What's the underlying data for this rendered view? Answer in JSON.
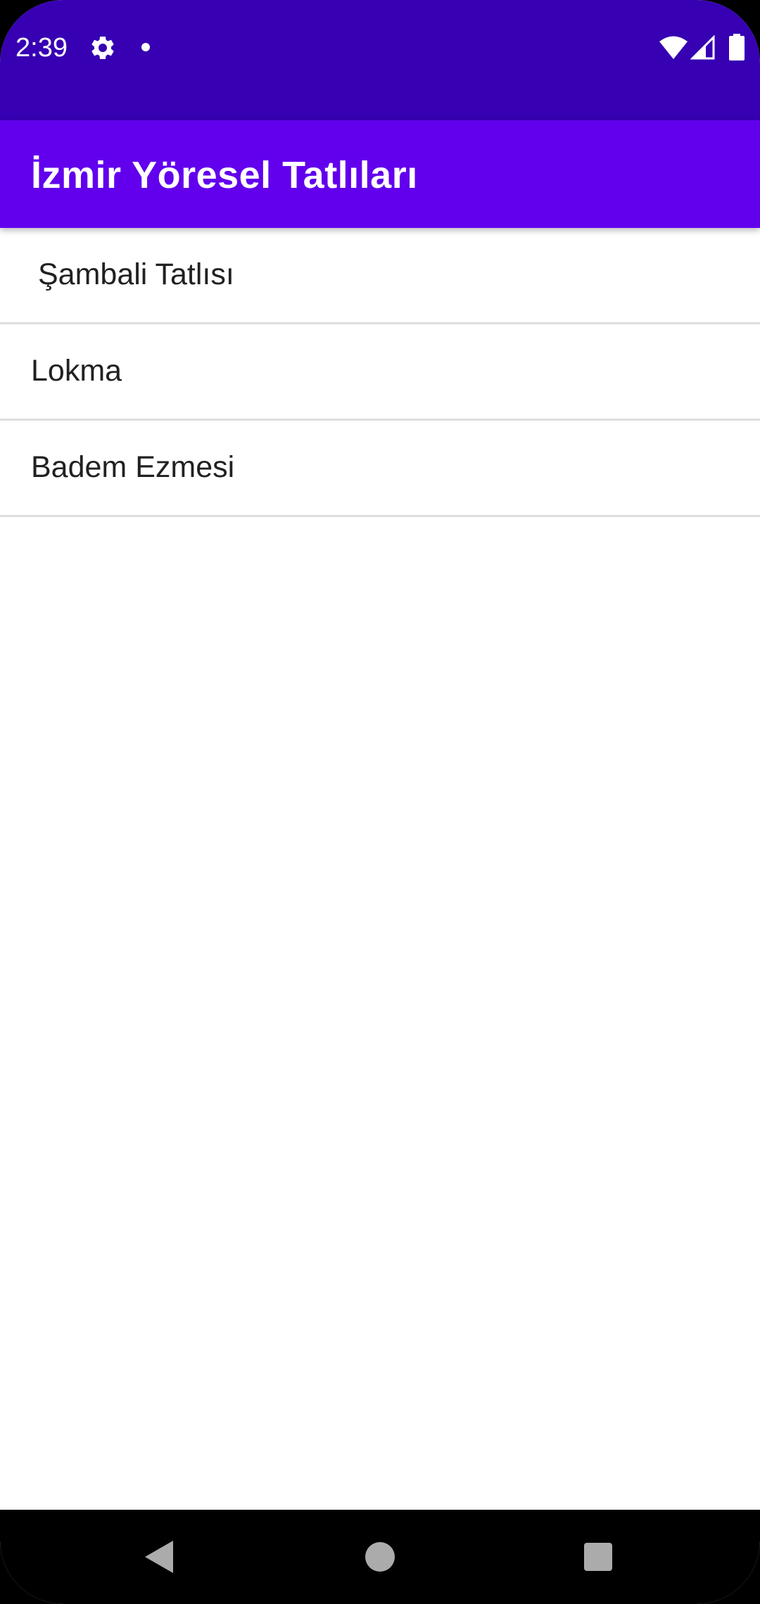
{
  "status_bar": {
    "time": "2:39",
    "background": "#3700B3",
    "icons": [
      "gear-icon",
      "notification-dot-icon",
      "wifi-icon",
      "cell-signal-icon",
      "battery-icon"
    ]
  },
  "app_bar": {
    "title": "İzmir Yöresel Tatlıları",
    "background": "#6200EE"
  },
  "list": {
    "items": [
      {
        "label": "Şambali Tatlısı"
      },
      {
        "label": "Lokma"
      },
      {
        "label": "Badem Ezmesi"
      }
    ]
  },
  "nav_bar": {
    "buttons": [
      "back-icon",
      "home-icon",
      "recents-icon"
    ]
  }
}
